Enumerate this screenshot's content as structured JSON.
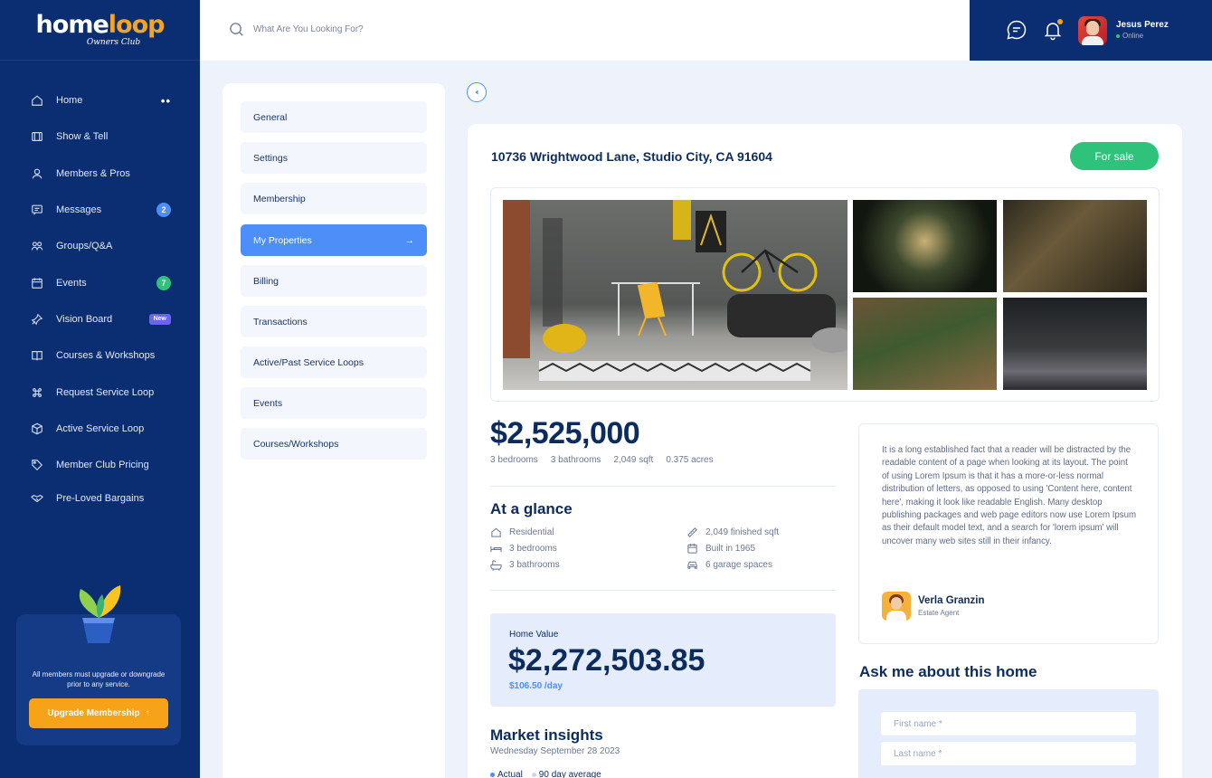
{
  "brand": {
    "logo_main_1": "home",
    "logo_main_2": "loop",
    "logo_sub": "Owners Club"
  },
  "sidebar": {
    "items": [
      {
        "label": "Home",
        "icon": "home-icon"
      },
      {
        "label": "Show & Tell",
        "icon": "film-icon"
      },
      {
        "label": "Members & Pros",
        "icon": "user-icon"
      },
      {
        "label": "Messages",
        "icon": "message-icon",
        "badge": "2"
      },
      {
        "label": "Groups/Q&A",
        "icon": "group-icon"
      },
      {
        "label": "Events",
        "icon": "calendar-icon",
        "badge": "7"
      },
      {
        "label": "Vision Board",
        "icon": "pin-icon",
        "badge": "New"
      },
      {
        "label": "Courses & Workshops",
        "icon": "book-icon"
      },
      {
        "label": "Request Service Loop",
        "icon": "command-icon"
      },
      {
        "label": "Active Service Loop",
        "icon": "box-icon"
      },
      {
        "label": "Member Club Pricing",
        "icon": "tag-icon"
      },
      {
        "label": "Pre-Loved Bargains",
        "icon": "handshake-icon"
      }
    ],
    "home_dots": "••",
    "upgrade": {
      "text": "All members must upgrade or downgrade prior to any service.",
      "button": "Upgrade Membership",
      "button_icon": "↑"
    }
  },
  "topbar": {
    "search_placeholder": "What Are You Looking For?",
    "user_name": "Jesus Perez",
    "user_status": "Online"
  },
  "settings_menu": {
    "items": [
      "General",
      "Settings",
      "Membership",
      "My Properties",
      "Billing",
      "Transactions",
      "Active/Past Service Loops",
      "Events",
      "Courses/Workshops"
    ],
    "active": "My Properties",
    "active_arrow": "→"
  },
  "property": {
    "address": "10736 Wrightwood Lane, Studio City, CA 91604",
    "status_button": "For sale",
    "price": "$2,525,000",
    "specs": [
      "3 bedrooms",
      "3 bathrooms",
      "2,049 sqft",
      "0.375 acres"
    ],
    "glance_title": "At a glance",
    "glance": {
      "type": "Residential",
      "bedrooms": "3 bedrooms",
      "bathrooms": "3 bathrooms",
      "sqft": "2,049 finished sqft",
      "built": "Built in 1965",
      "garage": "6 garage spaces"
    },
    "home_value": {
      "label": "Home Value",
      "value": "$2,272,503.85",
      "per_day": "$106.50 /day"
    },
    "market": {
      "title": "Market insights",
      "date": "Wednesday September 28 2023",
      "legend_actual": "Actual",
      "legend_avg": "90 day average",
      "actual_color": "#4d8ef8",
      "avg_color": "#cfd6e3"
    },
    "description": "It is a long established fact that a reader will be distracted by the readable content of a page when looking at its layout. The point of using Lorem Ipsum is that it has a more-or-less normal distribution of letters, as opposed to using 'Content here, content here', making it look like readable English. Many desktop publishing packages and web page editors now use Lorem Ipsum as their default model text, and a search for 'lorem ipsum' will uncover many web sites still in their infancy.",
    "agent": {
      "name": "Verla Granzin",
      "role": "Estate Agent"
    },
    "ask_title": "Ask me about this home",
    "form": {
      "first_name_placeholder": "First name *",
      "last_name_placeholder": "Last name *"
    }
  },
  "colors": {
    "sidebar": "#0b2e73",
    "accent": "#4d8ef8",
    "success": "#2fc27a",
    "warning": "#f6a317"
  }
}
